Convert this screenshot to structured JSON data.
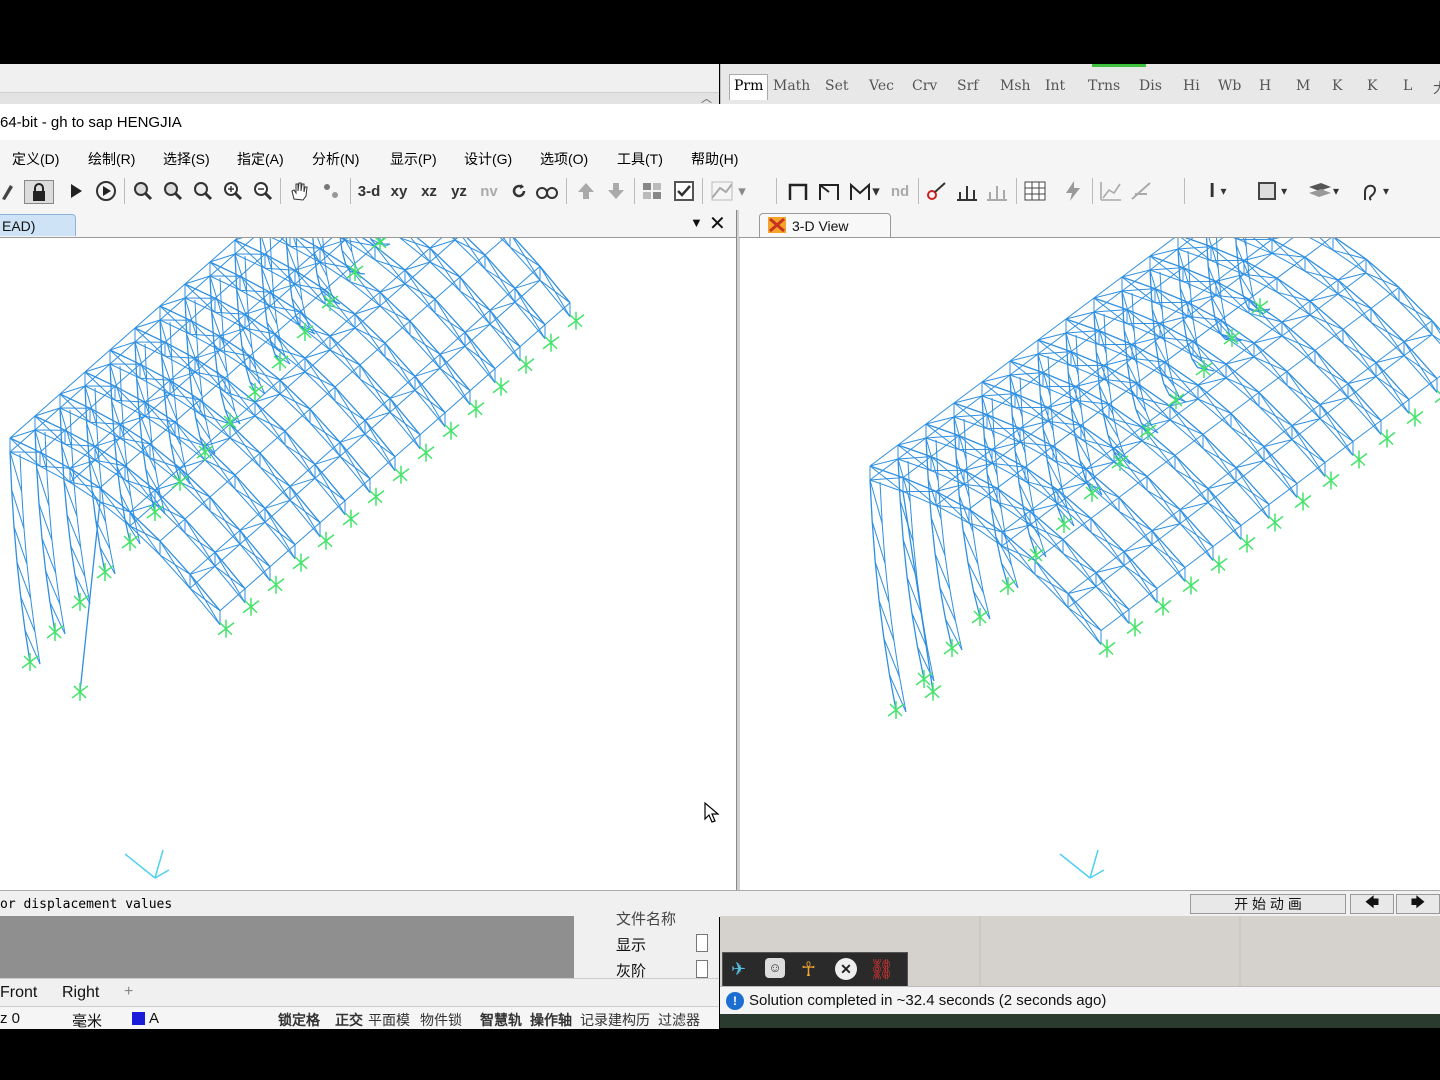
{
  "gh_tabs": {
    "items": [
      "Prm",
      "Math",
      "Set",
      "Vec",
      "Crv",
      "Srf",
      "Msh",
      "Int",
      "Trns",
      "Dis",
      "Hi",
      "Wb",
      "H",
      "M",
      "K",
      "K",
      "L",
      "大"
    ]
  },
  "sap": {
    "title": "64-bit - gh to sap HENGJIA",
    "menu": [
      "定义(D)",
      "绘制(R)",
      "选择(S)",
      "指定(A)",
      "分析(N)",
      "显示(P)",
      "设计(G)",
      "选项(O)",
      "工具(T)",
      "帮助(H)"
    ],
    "toolbar": {
      "view_3d": "3-d",
      "view_xy": "xy",
      "view_xz": "xz",
      "view_yz": "yz",
      "view_nv": "nv",
      "view_nd": "nd"
    },
    "left_view": {
      "tab_label": "EAD)"
    },
    "right_view": {
      "tab_label": "3-D View"
    },
    "status_message": "or displacement values",
    "animate_button": "开 始 动 画"
  },
  "rhino": {
    "props": {
      "file_name_label": "文件名称",
      "display_label": "显示",
      "grey_label": "灰阶"
    },
    "viewport_tabs": [
      "Front",
      "Right"
    ],
    "status": {
      "coord": "z 0",
      "units": "毫米",
      "layer": "A",
      "snap_items": [
        "锁定格",
        "正交",
        "平面模",
        "物件锁",
        "智慧轨",
        "操作轴",
        "记录建构历",
        "过滤器"
      ]
    },
    "colors": {
      "layer_swatch": "#1a1adb"
    }
  },
  "grasshopper": {
    "message": "Solution completed in ~32.4 seconds (2 seconds ago)"
  },
  "colors": {
    "frame_blue": "#2f8fe0",
    "support_green": "#44e36a"
  }
}
